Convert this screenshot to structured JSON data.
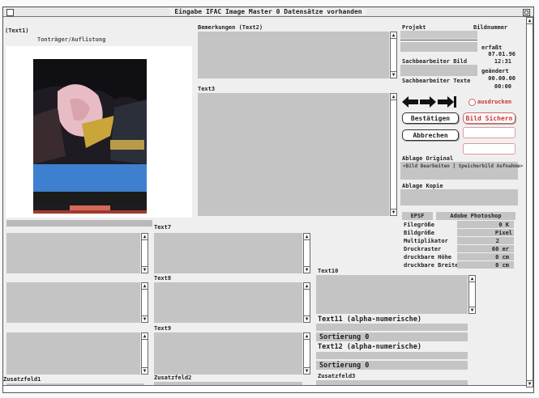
{
  "window": {
    "title": "Eingabe IFAC Image Master    0 Datensätze vorhanden"
  },
  "left": {
    "text1_label": "(Text1)",
    "subtitle": "Tonträger/Auflistung"
  },
  "mid": {
    "bemerkungen_label": "Bemerkungen (Text2)",
    "text3_label": "Text3"
  },
  "right": {
    "projekt_label": "Projekt",
    "bildnummer_label": "Bildnummer",
    "erfasst_label": "erfaßt",
    "erfasst_date": "07.01.96",
    "erfasst_time": "12:31",
    "sachbearbeiter_bild_label": "Sachbearbeiter Bild",
    "geaendert_label": "geändert",
    "geaendert_date": "00.00.00",
    "geaendert_time": "00:00",
    "sachbearbeiter_texte_label": "Sachbearbeiter Texte",
    "ausdrucken_label": "ausdrucken",
    "bestaetigen_label": "Bestätigen",
    "bild_sichern_label": "Bild Sichern",
    "abbrechen_label": "Abbrechen",
    "ablage_original_label": "Ablage Original",
    "ablage_original_value": "<Bild Bearbeiten ] Speicherbild Aufnahme>",
    "ablage_kopie_label": "Ablage Kopie",
    "tab_epsf": "EPSF",
    "tab_photoshop": "Adobe Photoshop",
    "specs": [
      {
        "label": "Filegröße",
        "value": "0 K"
      },
      {
        "label": "Bildgröße",
        "value": "Pixel"
      },
      {
        "label": "Multiplikator",
        "value": "2"
      },
      {
        "label": "Druckraster",
        "value": "60 er"
      },
      {
        "label": "druckbare Höhe",
        "value": "0 cm"
      },
      {
        "label": "druckbare Breite",
        "value": "0 cm"
      }
    ]
  },
  "bottom": {
    "text7_label": "Text7",
    "text8_label": "Text8",
    "text9_label": "Text9",
    "text10_label": "Text10",
    "text11_label": "Text11 (alpha-numerische)",
    "sortierung1_label": "Sortierung 0",
    "text12_label": "Text12 (alpha-numerische)",
    "sortierung2_label": "Sortierung 0",
    "zusatzfeld1_label": "Zusatzfeld1",
    "zusatzfeld2_label": "Zusatzfeld2",
    "zusatzfeld3_label": "Zusatzfeld3"
  },
  "colors": {
    "field": "#c4c4c4",
    "accent_red": "#cc3333"
  }
}
